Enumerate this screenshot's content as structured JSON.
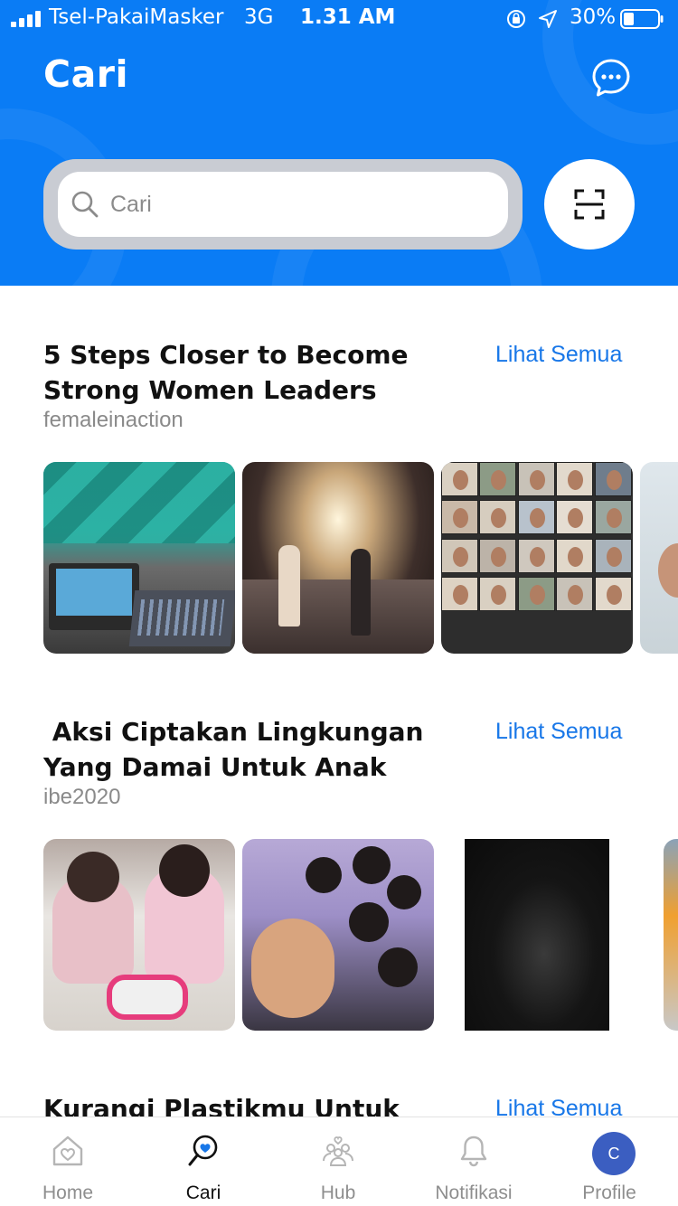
{
  "status_bar": {
    "carrier": "Tsel-PakaiMasker",
    "network": "3G",
    "time": "1.31 AM",
    "battery_percent": "30%",
    "battery_level": 0.3
  },
  "header": {
    "title": "Cari",
    "chat_icon": "chat-bubble-icon",
    "scan_icon": "scan-icon"
  },
  "search": {
    "placeholder": "Cari",
    "value": ""
  },
  "sections": [
    {
      "title": "5 Steps Closer to Become Strong Women Leaders",
      "author": "femaleinaction",
      "see_all": "Lihat Semua"
    },
    {
      "title": " Aksi Ciptakan Lingkungan Yang Damai Untuk Anak",
      "author": "ibe2020",
      "see_all": "Lihat Semua"
    },
    {
      "title": "Kurangi Plastikmu Untuk",
      "see_all": "Lihat Semua"
    }
  ],
  "tabbar": {
    "items": [
      {
        "label": "Home",
        "icon": "home-icon"
      },
      {
        "label": "Cari",
        "icon": "search-heart-icon"
      },
      {
        "label": "Hub",
        "icon": "hub-people-icon"
      },
      {
        "label": "Notifikasi",
        "icon": "bell-icon"
      },
      {
        "label": "Profile",
        "icon": "avatar"
      }
    ],
    "active": "Cari",
    "avatar_initial": "C"
  },
  "colors": {
    "header_blue": "#0a7cf5",
    "link_blue": "#1877e8",
    "avatar_blue": "#3b5ec1"
  }
}
